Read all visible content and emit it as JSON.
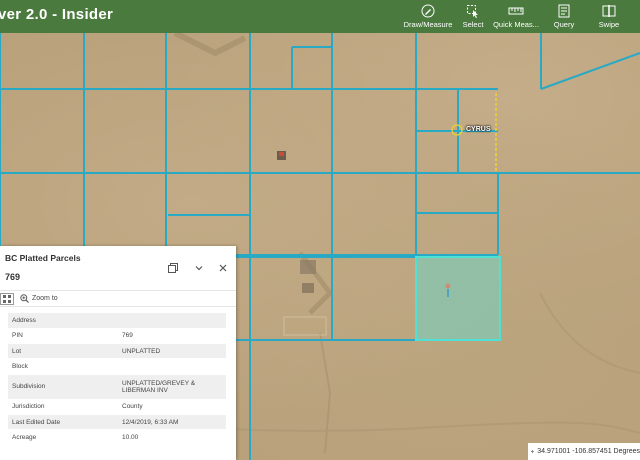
{
  "app": {
    "title": "ver 2.0 - Insider"
  },
  "toolbar": {
    "tools": [
      {
        "label": "Draw/Measure",
        "icon": "pencil-icon"
      },
      {
        "label": "Select",
        "icon": "select-cursor-icon"
      },
      {
        "label": "Quick Meas...",
        "icon": "ruler-icon"
      },
      {
        "label": "Query",
        "icon": "query-icon"
      },
      {
        "label": "Swipe",
        "icon": "swipe-icon"
      }
    ]
  },
  "map": {
    "place_label": "CYRUS",
    "parcel_color": "#29a9c4",
    "selected_fill": "#6fd3c4"
  },
  "popup": {
    "layer_title": "BC Platted Parcels",
    "feature_title": "769",
    "zoom_label": "Zoom to",
    "attributes": [
      {
        "field": "Address",
        "value": ""
      },
      {
        "field": "PIN",
        "value": "769"
      },
      {
        "field": "Lot",
        "value": "UNPLATTED"
      },
      {
        "field": "Block",
        "value": ""
      },
      {
        "field": "Subdivision",
        "value": "UNPLATTED/GREVEY & LIBERMAN INV"
      },
      {
        "field": "Jurisdiction",
        "value": "County"
      },
      {
        "field": "Last Edited Date",
        "value": "12/4/2019, 6:33 AM"
      },
      {
        "field": "Acreage",
        "value": "10.00"
      }
    ]
  },
  "coords": {
    "text": "34.971001 -106.857451 Degrees"
  }
}
